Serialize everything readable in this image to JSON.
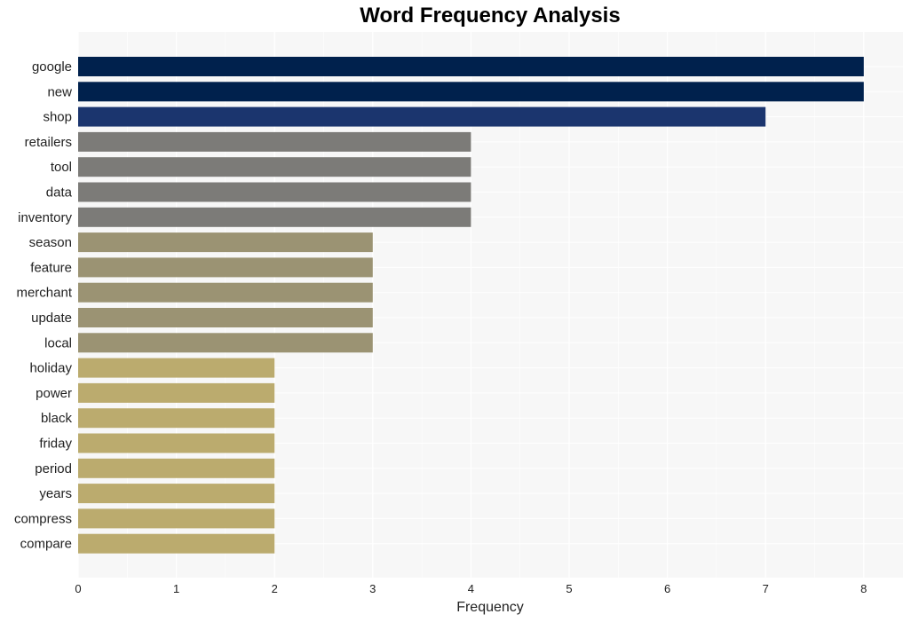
{
  "chart_data": {
    "type": "bar",
    "orientation": "horizontal",
    "title": "Word Frequency Analysis",
    "xlabel": "Frequency",
    "ylabel": "",
    "xlim": [
      0,
      8.4
    ],
    "xticks": [
      0,
      1,
      2,
      3,
      4,
      5,
      6,
      7,
      8
    ],
    "grid": true,
    "categories": [
      "google",
      "new",
      "shop",
      "retailers",
      "tool",
      "data",
      "inventory",
      "season",
      "feature",
      "merchant",
      "update",
      "local",
      "holiday",
      "power",
      "black",
      "friday",
      "period",
      "years",
      "compress",
      "compare"
    ],
    "values": [
      8,
      8,
      7,
      4,
      4,
      4,
      4,
      3,
      3,
      3,
      3,
      3,
      2,
      2,
      2,
      2,
      2,
      2,
      2,
      2
    ],
    "colors": {
      "8": "#00214d",
      "7": "#1b356e",
      "4": "#7c7b78",
      "3": "#9b9373",
      "2": "#bbab6e"
    },
    "plot_background": "#f7f7f7",
    "grid_color": "#ffffff"
  }
}
